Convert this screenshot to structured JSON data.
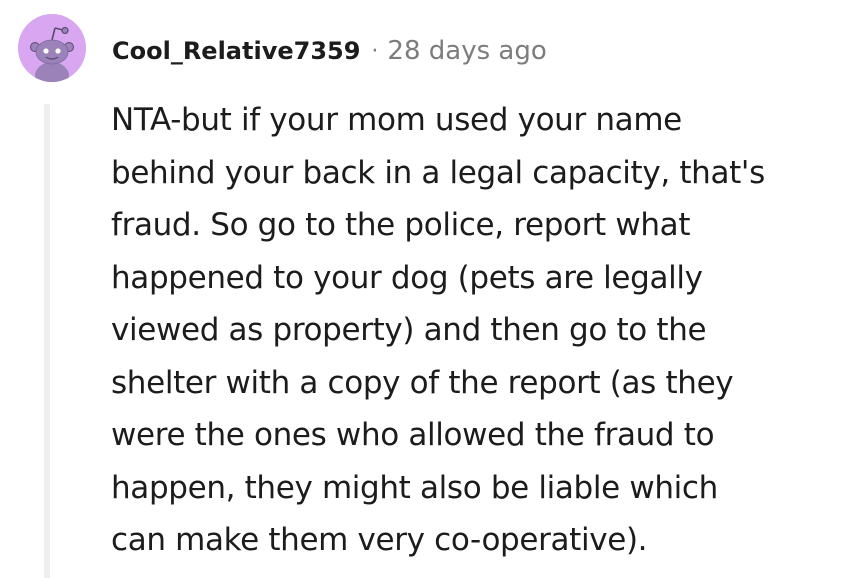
{
  "comment": {
    "author": "Cool_Relative7359",
    "separator": "·",
    "timestamp": "28 days ago",
    "avatar_icon": "snoo-avatar-icon",
    "avatar_color": "#d9a7f2",
    "body_lines": [
      "NTA-but if your mom used your name",
      "behind your back in a legal capacity, that's",
      "fraud. So go to the police, report what",
      "happened to your dog (pets are legally",
      "viewed as property) and then go to the",
      "shelter with a copy of the report (as they",
      "were the ones who allowed the fraud to",
      "happen, they might also be liable which",
      "can make them very co-operative)."
    ]
  },
  "colors": {
    "text": "#1c1c1c",
    "meta": "#7c7c7c",
    "thread_line": "#edeff1"
  }
}
